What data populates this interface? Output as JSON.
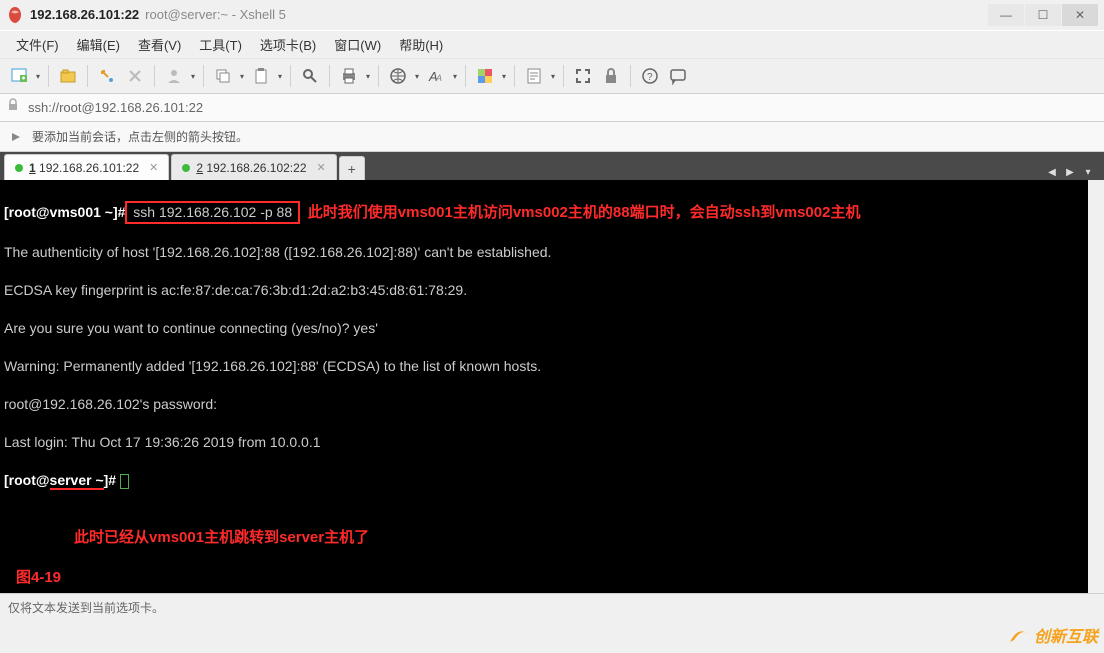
{
  "title": {
    "main": "192.168.26.101:22",
    "sub": "root@server:~ - Xshell 5"
  },
  "win": {
    "min": "—",
    "max": "☐",
    "close": "✕"
  },
  "menus": [
    "文件(F)",
    "编辑(E)",
    "查看(V)",
    "工具(T)",
    "选项卡(B)",
    "窗口(W)",
    "帮助(H)"
  ],
  "addr": "ssh://root@192.168.26.101:22",
  "infobar": "要添加当前会话，点击左侧的箭头按钮。",
  "tabs": [
    {
      "num": "1",
      "label": "192.168.26.101:22",
      "active": true
    },
    {
      "num": "2",
      "label": "192.168.26.102:22",
      "active": false
    }
  ],
  "tab_add": "+",
  "terminal": {
    "prompt1": "[root@vms001 ~]#",
    "cmd": " ssh 192.168.26.102 -p 88 ",
    "anno1": "此时我们使用vms001主机访问vms002主机的88端口时，会自动ssh到vms002主机",
    "l2": "The authenticity of host '[192.168.26.102]:88 ([192.168.26.102]:88)' can't be established.",
    "l3": "ECDSA key fingerprint is ac:fe:87:de:ca:76:3b:d1:2d:a2:b3:45:d8:61:78:29.",
    "l4": "Are you sure you want to continue connecting (yes/no)? yes'",
    "l5": "Warning: Permanently added '[192.168.26.102]:88' (ECDSA) to the list of known hosts.",
    "l6": "root@192.168.26.102's password:",
    "l7": "Last login: Thu Oct 17 19:36:26 2019 from 10.0.0.1",
    "prompt2a": "[root@",
    "prompt2b": "server ~",
    "prompt2c": "]# ",
    "anno2": "此时已经从vms001主机跳转到server主机了",
    "figlabel": "图4-19"
  },
  "statusbar": "仅将文本发送到当前选项卡。",
  "watermark": "创新互联"
}
